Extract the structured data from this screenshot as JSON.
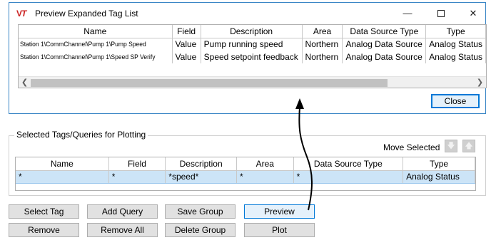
{
  "dialog": {
    "title": "Preview Expanded Tag List",
    "window_controls": {
      "minimize": "—",
      "close": "✕"
    },
    "columns": [
      "Name",
      "Field",
      "Description",
      "Area",
      "Data Source Type",
      "Type"
    ],
    "rows": [
      [
        "Station 1\\CommChannel\\Pump 1\\Pump Speed",
        "Value",
        "Pump running speed",
        "Northern",
        "Analog Data Source",
        "Analog Status"
      ],
      [
        "Station 1\\CommChannel\\Pump 1\\Speed SP Verify",
        "Value",
        "Speed setpoint feedback",
        "Northern",
        "Analog Data Source",
        "Analog Status"
      ]
    ],
    "close_label": "Close"
  },
  "selected": {
    "legend": "Selected Tags/Queries for Plotting",
    "move_selected_label": "Move Selected",
    "columns": [
      "Name",
      "Field",
      "Description",
      "Area",
      "Data Source Type",
      "Type"
    ],
    "rows": [
      [
        "*",
        "*",
        "*speed*",
        "*",
        "*",
        "Analog Status"
      ]
    ]
  },
  "buttons": {
    "select_tag": "Select Tag",
    "add_query": "Add Query",
    "save_group": "Save Group",
    "preview": "Preview",
    "remove": "Remove",
    "remove_all": "Remove All",
    "delete_group": "Delete Group",
    "plot": "Plot"
  },
  "icons": {
    "app": "vt-logo-icon",
    "move_down": "arrow-down-icon",
    "move_up": "arrow-up-icon",
    "scroll_left": "scroll-left-icon",
    "scroll_right": "scroll-right-icon"
  },
  "colors": {
    "dialog_border": "#3a86c6",
    "selection": "#cce4f7",
    "active_button": "#e5f1fb",
    "active_border": "#0078d7"
  }
}
